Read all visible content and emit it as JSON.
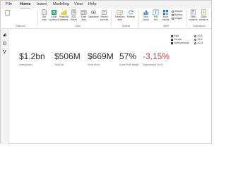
{
  "menu": {
    "tabs": [
      {
        "label": "File"
      },
      {
        "label": "Home"
      },
      {
        "label": "Insert"
      },
      {
        "label": "Modeling"
      },
      {
        "label": "View"
      },
      {
        "label": "Help"
      }
    ],
    "active_tab": "Home"
  },
  "ribbon": {
    "buttons": [
      {
        "label": "Get\ndata",
        "icon": "database-icon"
      },
      {
        "label": "Excel\nworkbook",
        "icon": "excel-icon"
      },
      {
        "label": "Power BI\ndatasets",
        "icon": "dataset-icon"
      },
      {
        "label": "SQL\nServer",
        "icon": "sql-server-icon"
      },
      {
        "label": "Enter\ndata",
        "icon": "table-icon"
      },
      {
        "label": "Dataverse",
        "icon": "dataverse-icon"
      },
      {
        "label": "Recent\nsources",
        "icon": "recent-sources-icon"
      },
      {
        "label": "Transform\ndata",
        "icon": "transform-icon"
      },
      {
        "label": "Refresh",
        "icon": "refresh-icon"
      },
      {
        "label": "New\nvisual",
        "icon": "new-visual-icon"
      },
      {
        "label": "Text\nbox",
        "icon": "text-box-icon"
      },
      {
        "label": "More\nvisuals",
        "icon": "more-visuals-icon"
      },
      {
        "label": "New\nmeasure",
        "icon": "calculator-icon"
      },
      {
        "label": "Quick\nmeasure",
        "icon": "quick-measure-icon"
      }
    ],
    "small_items": [
      "Shapes",
      "Buttons",
      "Images"
    ],
    "groups": [
      "Clipboard",
      "Data",
      "Queries",
      "Insert",
      "Calculations"
    ]
  },
  "canvas": {
    "cards": [
      {
        "value": "$1.2bn",
        "caption": "SalesAmount",
        "negative": false
      },
      {
        "value": "$506M",
        "caption": "TotalCost",
        "negative": false
      },
      {
        "value": "$669M",
        "caption": "Gross Profit",
        "negative": false
      },
      {
        "value": "57%",
        "caption": "Gross Profit Margin",
        "negative": false
      },
      {
        "value": "-3.15%",
        "caption": "SalesAmount YoY%",
        "negative": true
      }
    ],
    "slicer_regions": [
      {
        "label": "Asia",
        "checked": false
      },
      {
        "label": "Europe",
        "checked": false
      },
      {
        "label": "North America",
        "checked": true
      }
    ],
    "slicer_years": [
      {
        "label": "2011"
      },
      {
        "label": "2012"
      },
      {
        "label": "2013"
      }
    ]
  },
  "colors": {
    "accent": "#e8b300",
    "negative": "#d23b3b",
    "excel": "#21a366",
    "visual": "#2b7cd3"
  }
}
